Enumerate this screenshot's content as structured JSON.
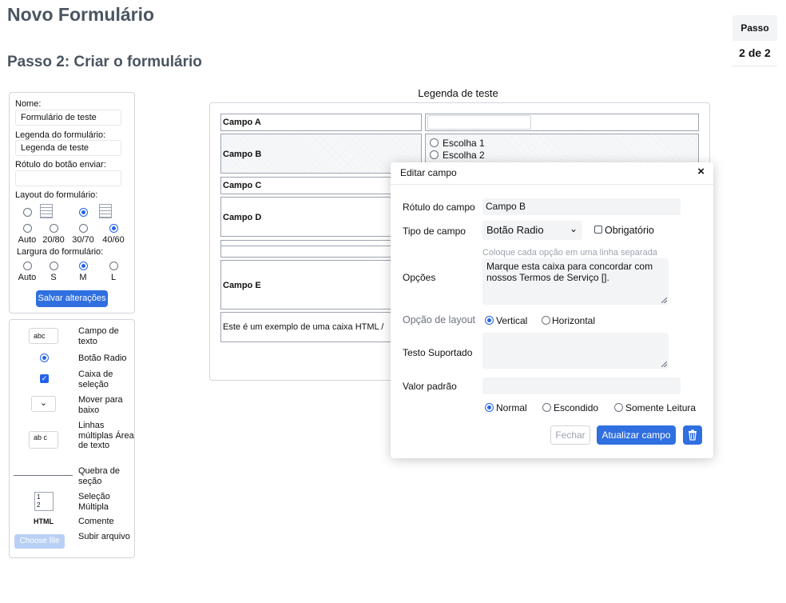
{
  "page": {
    "title": "Novo Formulário",
    "step_title": "Passo 2: Criar o formulário",
    "step_badge": {
      "label": "Passo",
      "value": "2 de 2"
    }
  },
  "settings": {
    "name_label": "Nome:",
    "name_value": "Formulário de teste",
    "legend_label": "Legenda do formulário:",
    "legend_value": "Legenda de teste",
    "submit_label": "Rótulo do botão enviar:",
    "submit_value": "",
    "layout_label": "Layout do formulário:",
    "layout_options": [
      "Auto",
      "20/80",
      "30/70",
      "40/60"
    ],
    "layout_selected": "40/60",
    "width_label": "Largura do formulário:",
    "width_options": [
      "Auto",
      "S",
      "M",
      "L"
    ],
    "width_selected": "M",
    "save_button": "Salvar alterações"
  },
  "tools": {
    "text_field_sample": "abc",
    "text_field": "Campo de texto",
    "radio": "Botão Radio",
    "checkbox": "Caixa de seleção",
    "dropdown": "Mover para baixo",
    "textarea_sample": "ab c",
    "textarea": "Linhas múltiplas Área de texto",
    "section_break": "Quebra de seção",
    "multi_select_sample": [
      "1",
      "2"
    ],
    "multi_select": "Seleção Múltipla",
    "html_sample": "HTML",
    "comment": "Comente",
    "upload_button": "Choose file",
    "upload": "Subir arquivo"
  },
  "preview": {
    "legend": "Legenda de teste",
    "field_a": "Campo A",
    "field_b": "Campo B",
    "field_b_options": [
      "Escolha 1",
      "Escolha 2"
    ],
    "field_c": "Campo C",
    "field_d": "Campo D",
    "field_e": "Campo E",
    "html_text": "Este é um exemplo de uma caixa HTML /"
  },
  "modal": {
    "title": "Editar campo",
    "close": "×",
    "label_label": "Rótulo do campo",
    "label_value": "Campo B",
    "type_label": "Tipo de campo",
    "type_value": "Botão Radio",
    "required_label": "Obrigatório",
    "options_hint": "Coloque cada opção em uma linha separada",
    "options_label": "Opções",
    "options_value": "Marque esta caixa para concordar com nossos Termos de Serviço [].",
    "layout_label": "Opção de layout",
    "layout_options": [
      "Vertical",
      "Horizontal"
    ],
    "layout_selected": "Vertical",
    "support_label": "Testo Suportado",
    "default_label": "Valor padrão",
    "visibility_options": [
      "Normal",
      "Escondido",
      "Somente Leitura"
    ],
    "visibility_selected": "Normal",
    "close_button": "Fechar",
    "update_button": "Atualizar campo"
  }
}
